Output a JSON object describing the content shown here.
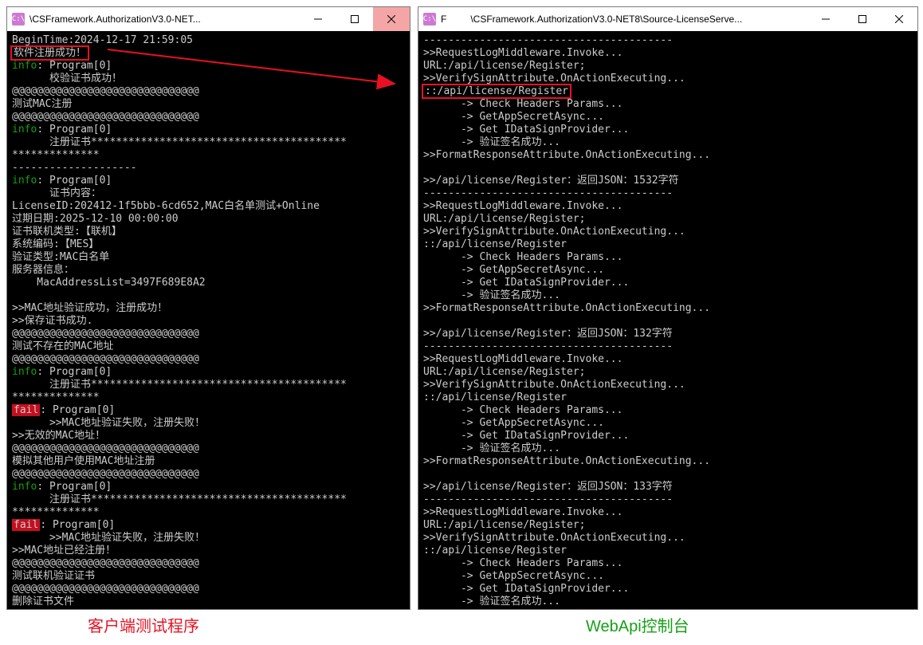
{
  "captions": {
    "left": "客户端测试程序",
    "right": "WebApi控制台"
  },
  "left": {
    "title": "\\CSFramework.AuthorizationV3.0-NET...",
    "icon": "C:\\",
    "lines": [
      {
        "t": "BeginTime:2024-12-17 21:59:05"
      },
      {
        "t": "软件注册成功！",
        "box": true
      },
      {
        "seg": [
          {
            "c": "g",
            "t": "info"
          },
          {
            "t": ": Program[0]"
          }
        ]
      },
      {
        "t": "      校验证书成功！"
      },
      {
        "t": "@@@@@@@@@@@@@@@@@@@@@@@@@@@@@@"
      },
      {
        "t": "测试MAC注册"
      },
      {
        "t": "@@@@@@@@@@@@@@@@@@@@@@@@@@@@@@"
      },
      {
        "seg": [
          {
            "c": "g",
            "t": "info"
          },
          {
            "t": ": Program[0]"
          }
        ]
      },
      {
        "t": "      注册证书*****************************************"
      },
      {
        "t": "**************"
      },
      {
        "t": "--------------------"
      },
      {
        "seg": [
          {
            "c": "g",
            "t": "info"
          },
          {
            "t": ": Program[0]"
          }
        ]
      },
      {
        "t": "      证书内容："
      },
      {
        "t": "LicenseID:202412-1f5bbb-6cd652,MAC白名单测试+Online"
      },
      {
        "t": "过期日期:2025-12-10 00:00:00"
      },
      {
        "t": "证书联机类型:【联机】"
      },
      {
        "t": "系统编码:【MES】"
      },
      {
        "t": "验证类型:MAC白名单"
      },
      {
        "t": "服务器信息："
      },
      {
        "t": "    MacAddressList=3497F689E8A2"
      },
      {
        "t": ""
      },
      {
        "t": ">>MAC地址验证成功，注册成功！"
      },
      {
        "t": ">>保存证书成功."
      },
      {
        "t": "@@@@@@@@@@@@@@@@@@@@@@@@@@@@@@"
      },
      {
        "t": "测试不存在的MAC地址"
      },
      {
        "t": "@@@@@@@@@@@@@@@@@@@@@@@@@@@@@@"
      },
      {
        "seg": [
          {
            "c": "g",
            "t": "info"
          },
          {
            "t": ": Program[0]"
          }
        ]
      },
      {
        "t": "      注册证书*****************************************"
      },
      {
        "t": "**************"
      },
      {
        "seg": [
          {
            "c": "fail",
            "t": "fail"
          },
          {
            "t": ": Program[0]"
          }
        ]
      },
      {
        "t": "      >>MAC地址验证失败，注册失败！"
      },
      {
        "t": ">>无效的MAC地址！"
      },
      {
        "t": "@@@@@@@@@@@@@@@@@@@@@@@@@@@@@@"
      },
      {
        "t": "模拟其他用户使用MAC地址注册"
      },
      {
        "t": "@@@@@@@@@@@@@@@@@@@@@@@@@@@@@@"
      },
      {
        "seg": [
          {
            "c": "g",
            "t": "info"
          },
          {
            "t": ": Program[0]"
          }
        ]
      },
      {
        "t": "      注册证书*****************************************"
      },
      {
        "t": "**************"
      },
      {
        "seg": [
          {
            "c": "fail",
            "t": "fail"
          },
          {
            "t": ": Program[0]"
          }
        ]
      },
      {
        "t": "      >>MAC地址验证失败，注册失败！"
      },
      {
        "t": ">>MAC地址已经注册！"
      },
      {
        "t": "@@@@@@@@@@@@@@@@@@@@@@@@@@@@@@"
      },
      {
        "t": "测试联机验证证书"
      },
      {
        "t": "@@@@@@@@@@@@@@@@@@@@@@@@@@@@@@"
      },
      {
        "t": "删除证书文件"
      }
    ]
  },
  "right": {
    "title": "\\CSFramework.AuthorizationV3.0-NET8\\Source-LicenseServe...",
    "icon": "C:\\",
    "lines": [
      {
        "t": "----------------------------------------"
      },
      {
        "t": ">>RequestLogMiddleware.Invoke..."
      },
      {
        "t": "URL:/api/license/Register;"
      },
      {
        "t": ">>VerifySignAttribute.OnActionExecuting..."
      },
      {
        "t": "::/api/license/Register",
        "box": true
      },
      {
        "t": "      -> Check Headers Params..."
      },
      {
        "t": "      -> GetAppSecretAsync..."
      },
      {
        "t": "      -> Get IDataSignProvider..."
      },
      {
        "t": "      -> 验证签名成功..."
      },
      {
        "t": ">>FormatResponseAttribute.OnActionExecuting..."
      },
      {
        "t": ""
      },
      {
        "t": ">>/api/license/Register：返回JSON：1532字符"
      },
      {
        "t": "----------------------------------------"
      },
      {
        "t": ">>RequestLogMiddleware.Invoke..."
      },
      {
        "t": "URL:/api/license/Register;"
      },
      {
        "t": ">>VerifySignAttribute.OnActionExecuting..."
      },
      {
        "t": "::/api/license/Register"
      },
      {
        "t": "      -> Check Headers Params..."
      },
      {
        "t": "      -> GetAppSecretAsync..."
      },
      {
        "t": "      -> Get IDataSignProvider..."
      },
      {
        "t": "      -> 验证签名成功..."
      },
      {
        "t": ">>FormatResponseAttribute.OnActionExecuting..."
      },
      {
        "t": ""
      },
      {
        "t": ">>/api/license/Register：返回JSON：132字符"
      },
      {
        "t": "----------------------------------------"
      },
      {
        "t": ">>RequestLogMiddleware.Invoke..."
      },
      {
        "t": "URL:/api/license/Register;"
      },
      {
        "t": ">>VerifySignAttribute.OnActionExecuting..."
      },
      {
        "t": "::/api/license/Register"
      },
      {
        "t": "      -> Check Headers Params..."
      },
      {
        "t": "      -> GetAppSecretAsync..."
      },
      {
        "t": "      -> Get IDataSignProvider..."
      },
      {
        "t": "      -> 验证签名成功..."
      },
      {
        "t": ">>FormatResponseAttribute.OnActionExecuting..."
      },
      {
        "t": ""
      },
      {
        "t": ">>/api/license/Register：返回JSON：133字符"
      },
      {
        "t": "----------------------------------------"
      },
      {
        "t": ">>RequestLogMiddleware.Invoke..."
      },
      {
        "t": "URL:/api/license/Register;"
      },
      {
        "t": ">>VerifySignAttribute.OnActionExecuting..."
      },
      {
        "t": "::/api/license/Register"
      },
      {
        "t": "      -> Check Headers Params..."
      },
      {
        "t": "      -> GetAppSecretAsync..."
      },
      {
        "t": "      -> Get IDataSignProvider..."
      },
      {
        "t": "      -> 验证签名成功..."
      }
    ]
  }
}
